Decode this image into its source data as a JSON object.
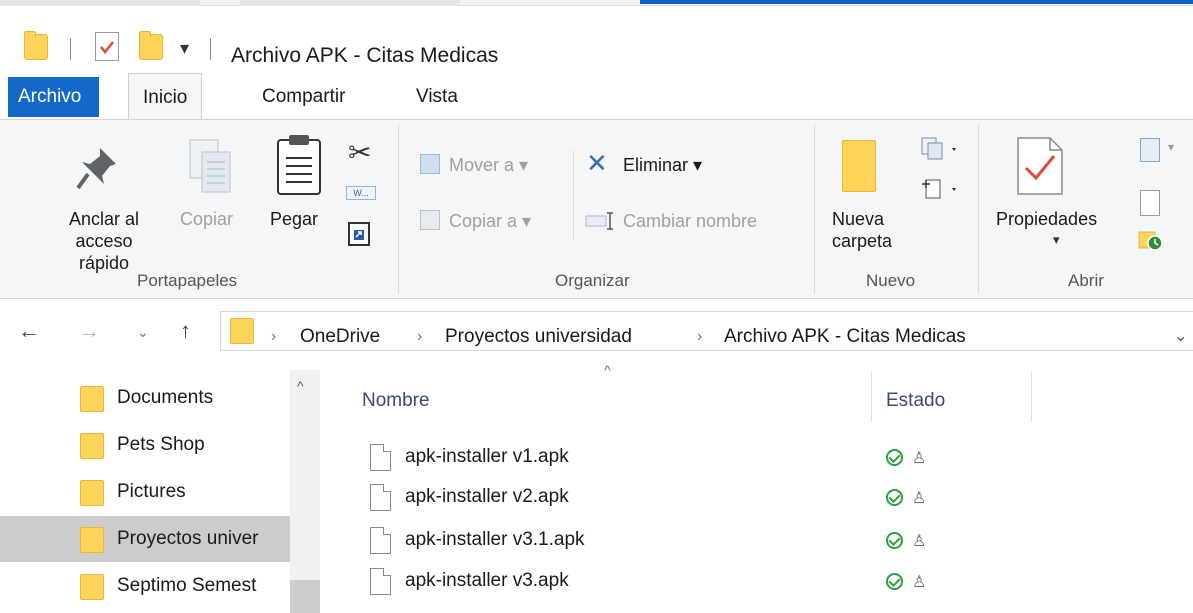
{
  "window": {
    "title": "Archivo APK - Citas Medicas",
    "accent": "#1468c8"
  },
  "quick_access": {
    "dropdown_glyph": "▾",
    "icons": [
      "folder-icon",
      "properties-check-icon",
      "new-folder-icon",
      "customize-dropdown-icon"
    ]
  },
  "tabs": [
    {
      "label": "Archivo"
    },
    {
      "label": "Inicio"
    },
    {
      "label": "Compartir"
    },
    {
      "label": "Vista"
    }
  ],
  "ribbon": {
    "portapapeles": {
      "group_label": "Portapapeles",
      "pin_line1": "Anclar al",
      "pin_line2": "acceso rápido",
      "copy": "Copiar",
      "paste": "Pegar"
    },
    "organizar": {
      "group_label": "Organizar",
      "move_to": "Mover a",
      "copy_to": "Copiar a",
      "delete": "Eliminar",
      "rename": "Cambiar nombre"
    },
    "nuevo": {
      "group_label": "Nuevo",
      "new_folder_line1": "Nueva",
      "new_folder_line2": "carpeta"
    },
    "abrir": {
      "group_label": "Abrir",
      "properties": "Propiedades"
    }
  },
  "address": {
    "crumbs": [
      "OneDrive",
      "Proyectos universidad",
      "Archivo APK - Citas Medicas"
    ]
  },
  "sidebar": {
    "items": [
      {
        "label": "Documents"
      },
      {
        "label": "Pets Shop"
      },
      {
        "label": "Pictures"
      },
      {
        "label": "Proyectos univer"
      },
      {
        "label": "Septimo Semest"
      }
    ]
  },
  "filelist": {
    "columns": {
      "name": "Nombre",
      "status": "Estado"
    },
    "files": [
      {
        "name": "apk-installer v1.apk"
      },
      {
        "name": "apk-installer v2.apk"
      },
      {
        "name": "apk-installer v3.1.apk"
      },
      {
        "name": "apk-installer v3.apk"
      }
    ],
    "status_color": "#2e9e3e"
  }
}
